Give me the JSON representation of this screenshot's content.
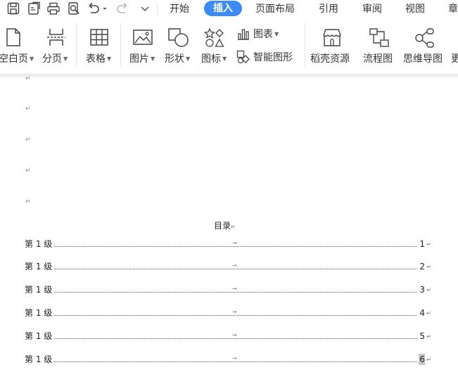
{
  "menubar": {
    "tabs": [
      {
        "label": "开始",
        "active": false
      },
      {
        "label": "插入",
        "active": true
      },
      {
        "label": "页面布局",
        "active": false
      },
      {
        "label": "引用",
        "active": false
      },
      {
        "label": "审阅",
        "active": false
      },
      {
        "label": "视图",
        "active": false
      },
      {
        "label": "章",
        "active": false
      }
    ],
    "accent_color": "#3b8af5"
  },
  "ribbon": {
    "blank_page": "空白页",
    "page_break": "分页",
    "table": "表格",
    "picture": "图片",
    "shape": "形状",
    "icon": "图标",
    "chart": "图表",
    "smart_art": "智能图形",
    "resources": "稻壳资源",
    "flowchart": "流程图",
    "mindmap": "思维导图",
    "more": "更"
  },
  "document": {
    "paragraph_mark": "↵",
    "toc_title": "目录",
    "toc_entries": [
      {
        "label": "第 1 级",
        "page": "1"
      },
      {
        "label": "第 1 级",
        "page": "2"
      },
      {
        "label": "第 1 级",
        "page": "3"
      },
      {
        "label": "第 1 级",
        "page": "4"
      },
      {
        "label": "第 1 级",
        "page": "5"
      },
      {
        "label": "第 1 级",
        "page": "6"
      }
    ]
  }
}
